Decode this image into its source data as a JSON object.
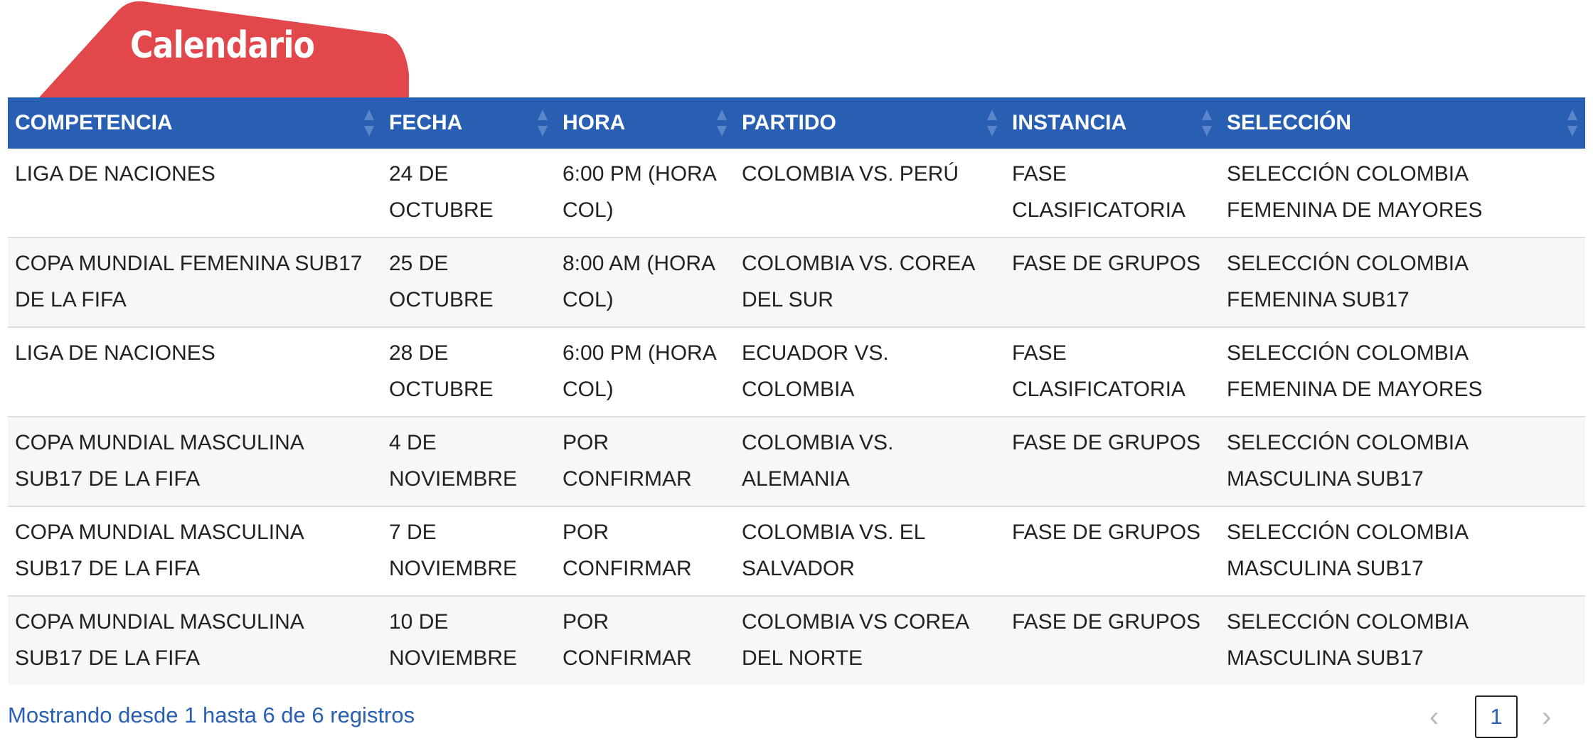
{
  "section": {
    "title": "Calendario",
    "tab_color": "#e2474b"
  },
  "table": {
    "header_color": "#285fb3",
    "columns": [
      "COMPETENCIA",
      "FECHA",
      "HORA",
      "PARTIDO",
      "INSTANCIA",
      "SELECCIÓN"
    ],
    "rows": [
      [
        "LIGA DE NACIONES",
        "24 DE OCTUBRE",
        "6:00 PM (HORA COL)",
        "COLOMBIA VS. PERÚ",
        "FASE CLASIFICATORIA",
        "SELECCIÓN COLOMBIA FEMENINA DE MAYORES"
      ],
      [
        "COPA MUNDIAL FEMENINA SUB17 DE LA FIFA",
        "25 DE OCTUBRE",
        "8:00 AM (HORA COL)",
        "COLOMBIA VS. COREA DEL SUR",
        "FASE DE GRUPOS",
        "SELECCIÓN COLOMBIA FEMENINA SUB17"
      ],
      [
        "LIGA DE NACIONES",
        "28 DE OCTUBRE",
        "6:00 PM (HORA COL)",
        "ECUADOR VS. COLOMBIA",
        "FASE CLASIFICATORIA",
        "SELECCIÓN COLOMBIA FEMENINA DE MAYORES"
      ],
      [
        "COPA MUNDIAL MASCULINA SUB17 DE LA FIFA",
        "4 DE NOVIEMBRE",
        "POR CONFIRMAR",
        "COLOMBIA VS. ALEMANIA",
        "FASE DE GRUPOS",
        "SELECCIÓN COLOMBIA MASCULINA SUB17"
      ],
      [
        "COPA MUNDIAL MASCULINA SUB17 DE LA FIFA",
        "7 DE NOVIEMBRE",
        "POR CONFIRMAR",
        "COLOMBIA VS. EL SALVADOR",
        "FASE DE GRUPOS",
        "SELECCIÓN COLOMBIA MASCULINA SUB17"
      ],
      [
        "COPA MUNDIAL MASCULINA SUB17 DE LA FIFA",
        "10 DE NOVIEMBRE",
        "POR CONFIRMAR",
        "COLOMBIA VS COREA DEL NORTE",
        "FASE DE GRUPOS",
        "SELECCIÓN COLOMBIA MASCULINA SUB17"
      ]
    ]
  },
  "footer": {
    "info": "Mostrando desde 1 hasta 6 de 6 registros",
    "pagination": {
      "prev_icon": "chevron-left-icon",
      "current_page": "1",
      "next_icon": "chevron-right-icon"
    }
  }
}
